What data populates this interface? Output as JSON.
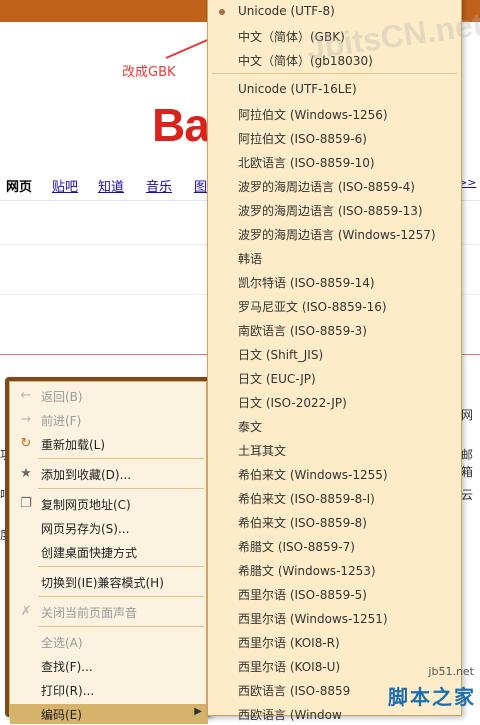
{
  "annotation": {
    "text": "改成GBK"
  },
  "logo_fragment": "Ba",
  "nav": {
    "items": [
      "网页",
      "贴吧",
      "知道",
      "音乐",
      "图"
    ],
    "more": ">>"
  },
  "page_fragments": {
    "right": [
      "网",
      "邮箱",
      "云"
    ],
    "left": [
      "功",
      "吧",
      "度"
    ]
  },
  "context_menu": {
    "items": [
      {
        "label": "返回(B)",
        "icon": "back-arrow-icon",
        "disabled": true
      },
      {
        "label": "前进(F)",
        "icon": "forward-arrow-icon",
        "disabled": true
      },
      {
        "label": "重新加载(L)",
        "icon": "reload-icon",
        "disabled": false
      },
      {
        "label": "添加到收藏(D)...",
        "icon": "star-icon",
        "disabled": false
      },
      {
        "label": "复制网页地址(C)",
        "icon": "copy-icon",
        "disabled": false
      },
      {
        "label": "网页另存为(S)...",
        "icon": "",
        "disabled": false
      },
      {
        "label": "创建桌面快捷方式",
        "icon": "",
        "disabled": false
      },
      {
        "label": "切换到(IE)兼容模式(H)",
        "icon": "",
        "disabled": false
      },
      {
        "label": "关闭当前页面声音",
        "icon": "mute-icon",
        "disabled": true
      },
      {
        "label": "全选(A)",
        "icon": "",
        "disabled": true
      },
      {
        "label": "查找(F)...",
        "icon": "",
        "disabled": false
      },
      {
        "label": "打印(R)...",
        "icon": "",
        "disabled": false
      },
      {
        "label": "编码(E)",
        "icon": "",
        "disabled": false,
        "submenu": true
      }
    ]
  },
  "encoding_menu": {
    "selected": "Unicode (UTF-8)",
    "items": [
      "Unicode (UTF-8)",
      "中文（简体）(GBK)",
      "中文（简体）(gb18030)",
      "Unicode (UTF-16LE)",
      "阿拉伯文 (Windows-1256)",
      "阿拉伯文 (ISO-8859-6)",
      "北欧语言 (ISO-8859-10)",
      "波罗的海周边语言 (ISO-8859-4)",
      "波罗的海周边语言 (ISO-8859-13)",
      "波罗的海周边语言 (Windows-1257)",
      "韩语",
      "凯尔特语 (ISO-8859-14)",
      "罗马尼亚文 (ISO-8859-16)",
      "南欧语言 (ISO-8859-3)",
      "日文 (Shift_JIS)",
      "日文 (EUC-JP)",
      "日文 (ISO-2022-JP)",
      "泰文",
      "土耳其文",
      "希伯来文 (Windows-1255)",
      "希伯来文 (ISO-8859-8-I)",
      "希伯来文 (ISO-8859-8)",
      "希腊文 (ISO-8859-7)",
      "希腊文 (Windows-1253)",
      "西里尔语 (ISO-8859-5)",
      "西里尔语 (Windows-1251)",
      "西里尔语 (KOI8-R)",
      "西里尔语 (KOI8-U)",
      "西欧语言 (ISO-8859",
      "西欧语言 (Window"
    ]
  },
  "watermarks": {
    "top": "JbitsCN.net",
    "site": "jb51.net",
    "brand": "脚本之家"
  },
  "colors": {
    "menu_bg": "#fdecc7",
    "context_border": "#7a4a1f",
    "annotation": "#e53935"
  }
}
